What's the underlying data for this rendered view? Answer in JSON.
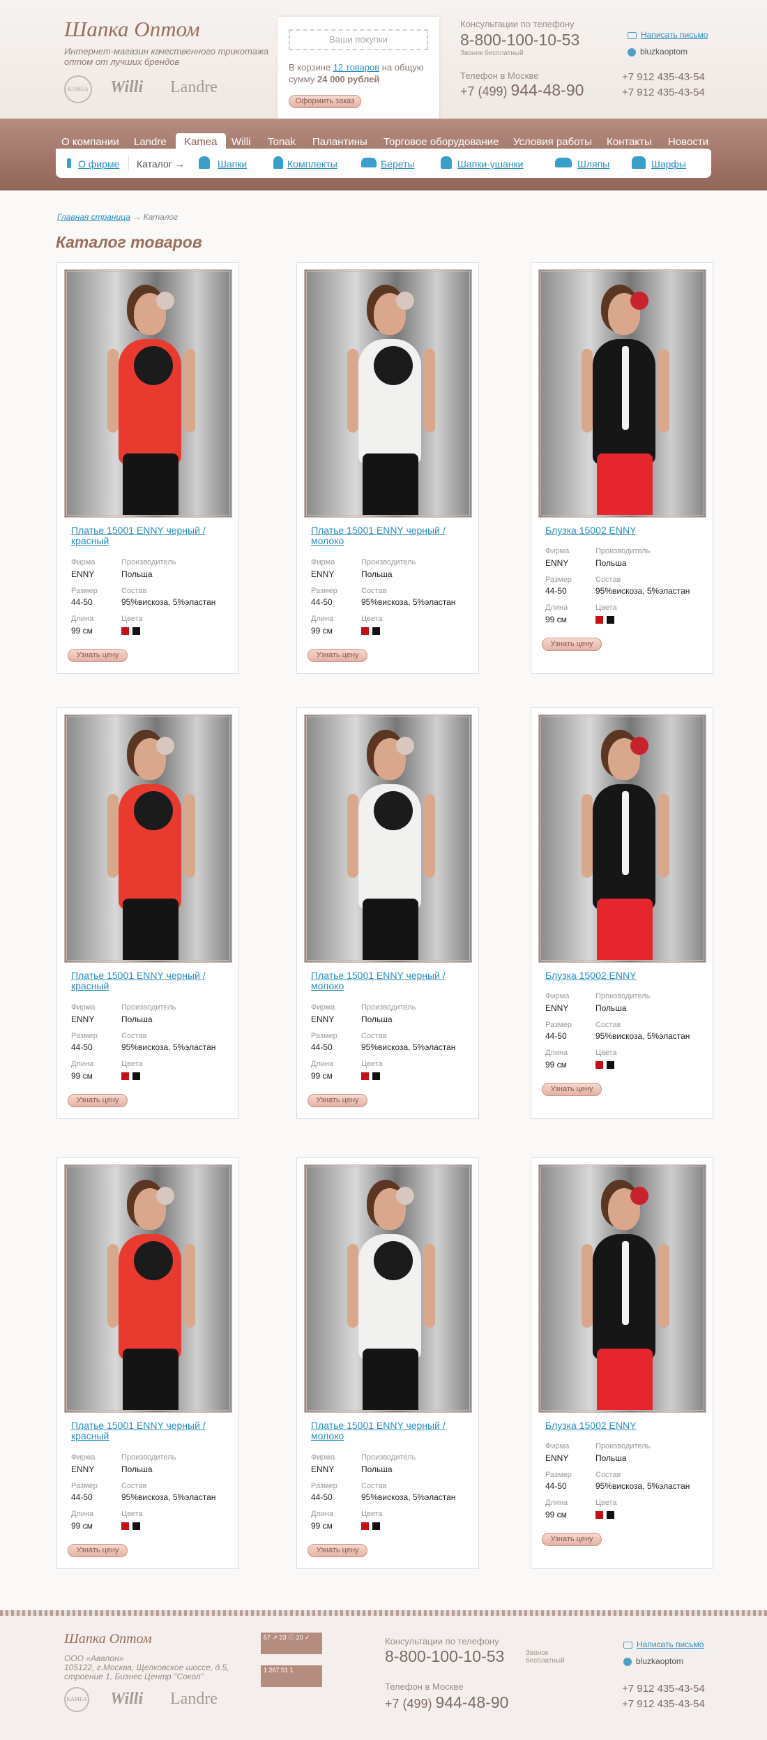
{
  "header": {
    "logo": "Шапка Оптом",
    "tagline": "Интернет-магазин качественного трикотажа оптом от лучших брендов",
    "brands": [
      "KAMEA",
      "Willi",
      "Landre"
    ],
    "cart": {
      "title": "Ваши покупки",
      "text_before": "В корзине ",
      "items_link": "12 товаров",
      "text_after": " на общую сумму ",
      "total": "24 000 рублей",
      "order_button": "Оформить заказ"
    },
    "phone_label": "Консультации по телефону",
    "phone": "8-800-100-10-53",
    "phone_note": "Звонок бесплатный",
    "moscow_label": "Телефон в Москве",
    "moscow_code": "+7 (499) ",
    "moscow_phone": "944-48-90",
    "write_link": "Написать письмо",
    "skype": "bluzkaoptom",
    "mobile1": "+7 912 435-43-54",
    "mobile2": "+7 912 435-43-54"
  },
  "nav": {
    "tabs": [
      "О компании",
      "Landre",
      "Kamea",
      "Willi",
      "Tonak",
      "Палантины",
      "Торговое оборудование",
      "Условия работы",
      "Контакты",
      "Новости"
    ],
    "active": "Kamea",
    "sub": {
      "about": "О фирме",
      "catalog": "Каталог →",
      "items": [
        "Шапки",
        "Комплекты",
        "Береты",
        "Шапки-ушанки",
        "Шляпы",
        "Шарфы"
      ]
    }
  },
  "breadcrumb": {
    "home": "Главная страница",
    "arrow": " → ",
    "current": "Каталог"
  },
  "page_title": "Каталог товаров",
  "labels": {
    "firm": "Фирма",
    "maker": "Производитель",
    "size": "Размер",
    "composition": "Состав",
    "length": "Длина",
    "colors": "Цвета",
    "price_button": "Узнать цену"
  },
  "products": [
    {
      "name": "Платье 15001 ENNY черный / красный",
      "firm": "ENNY",
      "maker": "Польша",
      "size": "44-50",
      "composition": "95%вискоза, 5%эластан",
      "length": "99 см",
      "colors": [
        "#c40f14",
        "#111111"
      ],
      "dress": "red"
    },
    {
      "name": "Платье 15001 ENNY черный / молоко",
      "firm": "ENNY",
      "maker": "Польша",
      "size": "44-50",
      "composition": "95%вискоза, 5%эластан",
      "length": "99 см",
      "colors": [
        "#c40f14",
        "#111111"
      ],
      "dress": "white"
    },
    {
      "name": "Блузка 15002 ENNY",
      "firm": "ENNY",
      "maker": "Польша",
      "size": "44-50",
      "composition": "95%вискоза, 5%эластан",
      "length": "99 см",
      "colors": [
        "#c40f14",
        "#111111"
      ],
      "dress": "blouse"
    },
    {
      "name": "Платье 15001 ENNY черный / красный",
      "firm": "ENNY",
      "maker": "Польша",
      "size": "44-50",
      "composition": "95%вискоза, 5%эластан",
      "length": "99 см",
      "colors": [
        "#c40f14",
        "#111111"
      ],
      "dress": "red"
    },
    {
      "name": "Платье 15001 ENNY черный / молоко",
      "firm": "ENNY",
      "maker": "Польша",
      "size": "44-50",
      "composition": "95%вискоза, 5%эластан",
      "length": "99 см",
      "colors": [
        "#c40f14",
        "#111111"
      ],
      "dress": "white"
    },
    {
      "name": "Блузка 15002 ENNY",
      "firm": "ENNY",
      "maker": "Польша",
      "size": "44-50",
      "composition": "95%вискоза, 5%эластан",
      "length": "99 см",
      "colors": [
        "#c40f14",
        "#111111"
      ],
      "dress": "blouse"
    },
    {
      "name": "Платье 15001 ENNY черный / красный",
      "firm": "ENNY",
      "maker": "Польша",
      "size": "44-50",
      "composition": "95%вискоза, 5%эластан",
      "length": "99 см",
      "colors": [
        "#c40f14",
        "#111111"
      ],
      "dress": "red"
    },
    {
      "name": "Платье 15001 ENNY черный / молоко",
      "firm": "ENNY",
      "maker": "Польша",
      "size": "44-50",
      "composition": "95%вискоза, 5%эластан",
      "length": "99 см",
      "colors": [
        "#c40f14",
        "#111111"
      ],
      "dress": "white"
    },
    {
      "name": "Блузка 15002 ENNY",
      "firm": "ENNY",
      "maker": "Польша",
      "size": "44-50",
      "composition": "95%вискоза, 5%эластан",
      "length": "99 см",
      "colors": [
        "#c40f14",
        "#111111"
      ],
      "dress": "blouse"
    }
  ],
  "footer": {
    "logo": "Шапка Оптом",
    "company": "ООО «Авалон»",
    "address": "105122, г.Москва, Щелковское шоссе, д.5, строение 1, Бизнес Центр \"Сокол\"",
    "counter1": "57 ↗ 23 ⓘ 20 ✓",
    "counter2": "1 267 51 1",
    "phone_label": "Консультации по телефону",
    "phone": "8-800-100-10-53",
    "phone_note": "Звонок бесплатный",
    "moscow_label": "Телефон в Москве",
    "moscow_code": "+7 (499) ",
    "moscow_phone": "944-48-90",
    "write_link": "Написать письмо",
    "skype": "bluzkaoptom",
    "mobile1": "+7 912 435-43-54",
    "mobile2": "+7 912 435-43-54"
  }
}
